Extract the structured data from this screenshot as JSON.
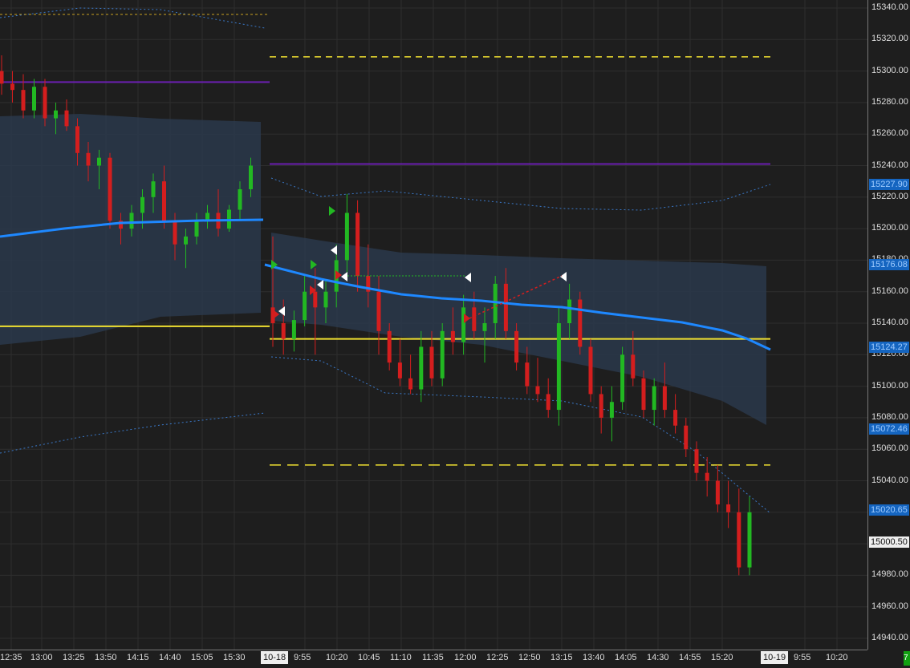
{
  "price_axis": {
    "labels": [
      "15340.00",
      "15320.00",
      "15300.00",
      "15280.00",
      "15260.00",
      "15240.00",
      "15220.00",
      "15200.00",
      "15180.00",
      "15160.00",
      "15140.00",
      "15120.00",
      "15100.00",
      "15080.00",
      "15060.00",
      "15040.00",
      "15020.00",
      "15000.00",
      "14980.00",
      "14960.00",
      "14940.00"
    ]
  },
  "price_tags": [
    {
      "text": "15227.90",
      "bg": "#1565c0",
      "fg": "#9ecbff"
    },
    {
      "text": "15176.08",
      "bg": "#1565c0",
      "fg": "#9ecbff"
    },
    {
      "text": "15124.27",
      "bg": "#1565c0",
      "fg": "#9ecbff"
    },
    {
      "text": "15072.46",
      "bg": "#1565c0",
      "fg": "#9ecbff"
    },
    {
      "text": "15020.65",
      "bg": "#1565c0",
      "fg": "#9ecbff"
    },
    {
      "text": "15000.50",
      "bg": "#eeeeee",
      "fg": "#111111"
    }
  ],
  "time_axis": {
    "labels": [
      "12:35",
      "13:00",
      "13:25",
      "13:50",
      "14:15",
      "14:40",
      "15:05",
      "15:30",
      "9:55",
      "10:20",
      "10:45",
      "11:10",
      "11:35",
      "12:00",
      "12:25",
      "12:50",
      "13:15",
      "13:40",
      "14:05",
      "14:30",
      "14:55",
      "15:20",
      "9:55",
      "10:20"
    ],
    "date_markers": [
      "10-18",
      "10-19"
    ]
  },
  "corner_badge": "7",
  "colors": {
    "background": "#1e1e1e",
    "grid": "#2e2e2e",
    "bull": "#22b822",
    "bear": "#d41e1e",
    "vwap": "#1e88ff",
    "band_fill": "#2a3a4e",
    "yellow": "#f0e030",
    "purple": "#6a1fb0"
  },
  "chart_data": {
    "type": "candlestick",
    "symbol_price_levels": {
      "yellow_solid_prev": 15138,
      "yellow_solid": 15130,
      "yellow_dashed_high": 15309,
      "yellow_dashed_low": 15050,
      "purple_prev": 15293,
      "purple": 15241
    },
    "ylim": [
      14940,
      15340
    ],
    "session_2_candles_ohlc": [
      [
        15150,
        15195,
        15125,
        15140
      ],
      [
        15140,
        15155,
        15120,
        15130
      ],
      [
        15130,
        15148,
        15122,
        15142
      ],
      [
        15142,
        15170,
        15138,
        15160
      ],
      [
        15160,
        15175,
        15120,
        15150
      ],
      [
        15150,
        15168,
        15140,
        15160
      ],
      [
        15160,
        15190,
        15150,
        15180
      ],
      [
        15180,
        15222,
        15170,
        15210
      ],
      [
        15210,
        15218,
        15160,
        15170
      ],
      [
        15170,
        15190,
        15150,
        15160
      ],
      [
        15160,
        15170,
        15120,
        15135
      ],
      [
        15135,
        15140,
        15110,
        15115
      ],
      [
        15115,
        15130,
        15100,
        15105
      ],
      [
        15105,
        15120,
        15095,
        15098
      ],
      [
        15098,
        15135,
        15090,
        15125
      ],
      [
        15125,
        15135,
        15100,
        15105
      ],
      [
        15105,
        15140,
        15100,
        15135
      ],
      [
        15135,
        15150,
        15120,
        15128
      ],
      [
        15128,
        15158,
        15120,
        15150
      ],
      [
        15150,
        15160,
        15130,
        15135
      ],
      [
        15135,
        15150,
        15115,
        15140
      ],
      [
        15140,
        15170,
        15130,
        15165
      ],
      [
        15165,
        15175,
        15130,
        15135
      ],
      [
        15135,
        15140,
        15110,
        15115
      ],
      [
        15115,
        15125,
        15095,
        15100
      ],
      [
        15100,
        15118,
        15090,
        15095
      ],
      [
        15095,
        15105,
        15080,
        15085
      ],
      [
        15085,
        15150,
        15075,
        15140
      ],
      [
        15140,
        15165,
        15130,
        15155
      ],
      [
        15155,
        15160,
        15120,
        15125
      ],
      [
        15125,
        15130,
        15090,
        15095
      ],
      [
        15095,
        15100,
        15070,
        15080
      ],
      [
        15080,
        15100,
        15065,
        15090
      ],
      [
        15090,
        15125,
        15085,
        15120
      ],
      [
        15120,
        15135,
        15100,
        15105
      ],
      [
        15105,
        15110,
        15080,
        15085
      ],
      [
        15085,
        15105,
        15075,
        15100
      ],
      [
        15100,
        15115,
        15080,
        15085
      ],
      [
        15085,
        15095,
        15070,
        15075
      ],
      [
        15075,
        15080,
        15055,
        15060
      ],
      [
        15060,
        15065,
        15040,
        15045
      ],
      [
        15045,
        15055,
        15030,
        15040
      ],
      [
        15040,
        15050,
        15020,
        15025
      ],
      [
        15025,
        15040,
        15010,
        15020
      ],
      [
        15020,
        15035,
        14980,
        14985
      ],
      [
        14985,
        15030,
        14980,
        15020
      ]
    ],
    "ylabel": "",
    "xlabel": ""
  }
}
